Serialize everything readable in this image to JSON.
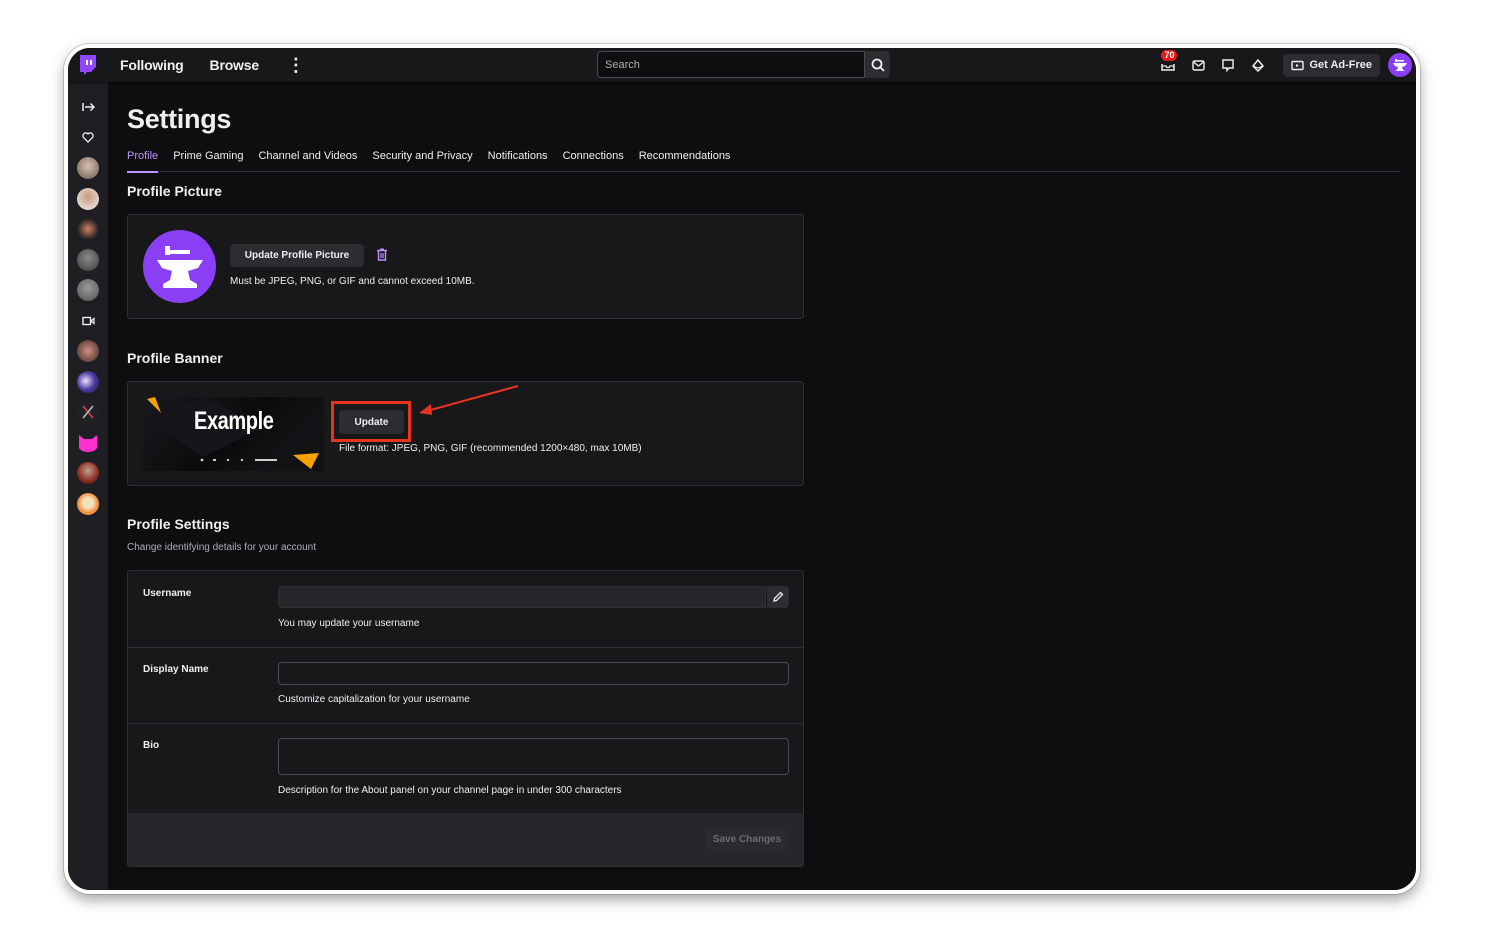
{
  "topnav": {
    "logo": "twitch-logo",
    "links": [
      "Following",
      "Browse"
    ],
    "search_placeholder": "Search",
    "notification_count": "70",
    "get_ad_free": "Get Ad-Free"
  },
  "sidebar": {
    "items": [
      {
        "type": "icon",
        "name": "collapse-arrow-icon"
      },
      {
        "type": "icon",
        "name": "heart-icon"
      },
      {
        "type": "avatar",
        "color": "#8a7a70"
      },
      {
        "type": "avatar",
        "color": "#c9b8a8"
      },
      {
        "type": "avatar",
        "color": "#6b2a24"
      },
      {
        "type": "avatar",
        "color": "#4a4a4a"
      },
      {
        "type": "avatar",
        "color": "#6a6a6a"
      },
      {
        "type": "icon",
        "name": "video-camera-icon"
      },
      {
        "type": "avatar",
        "color": "#b07a68"
      },
      {
        "type": "avatar",
        "color": "#3a2a7a"
      },
      {
        "type": "avatar",
        "color": "#222226"
      },
      {
        "type": "avatar",
        "color": "#ff2fd0"
      },
      {
        "type": "avatar",
        "color": "#7a3a30"
      },
      {
        "type": "avatar",
        "color": "#e89040"
      }
    ]
  },
  "page": {
    "title": "Settings",
    "tabs": [
      "Profile",
      "Prime Gaming",
      "Channel and Videos",
      "Security and Privacy",
      "Notifications",
      "Connections",
      "Recommendations"
    ],
    "active_tab": "Profile"
  },
  "profile_picture": {
    "title": "Profile Picture",
    "button": "Update Profile Picture",
    "hint": "Must be JPEG, PNG, or GIF and cannot exceed 10MB."
  },
  "profile_banner": {
    "title": "Profile Banner",
    "banner_text": "Example",
    "button": "Update",
    "hint": "File format: JPEG, PNG, GIF (recommended 1200×480, max 10MB)"
  },
  "profile_settings": {
    "title": "Profile Settings",
    "subtitle": "Change identifying details for your account",
    "username": {
      "label": "Username",
      "value": "",
      "hint": "You may update your username"
    },
    "display_name": {
      "label": "Display Name",
      "value": "",
      "hint": "Customize capitalization for your username"
    },
    "bio": {
      "label": "Bio",
      "value": "",
      "hint": "Description for the About panel on your channel page in under 300 characters"
    },
    "save_button": "Save Changes"
  },
  "colors": {
    "accent": "#bf94ff",
    "brand": "#9146ff",
    "annotation": "#e8331f",
    "badge": "#e91916"
  }
}
